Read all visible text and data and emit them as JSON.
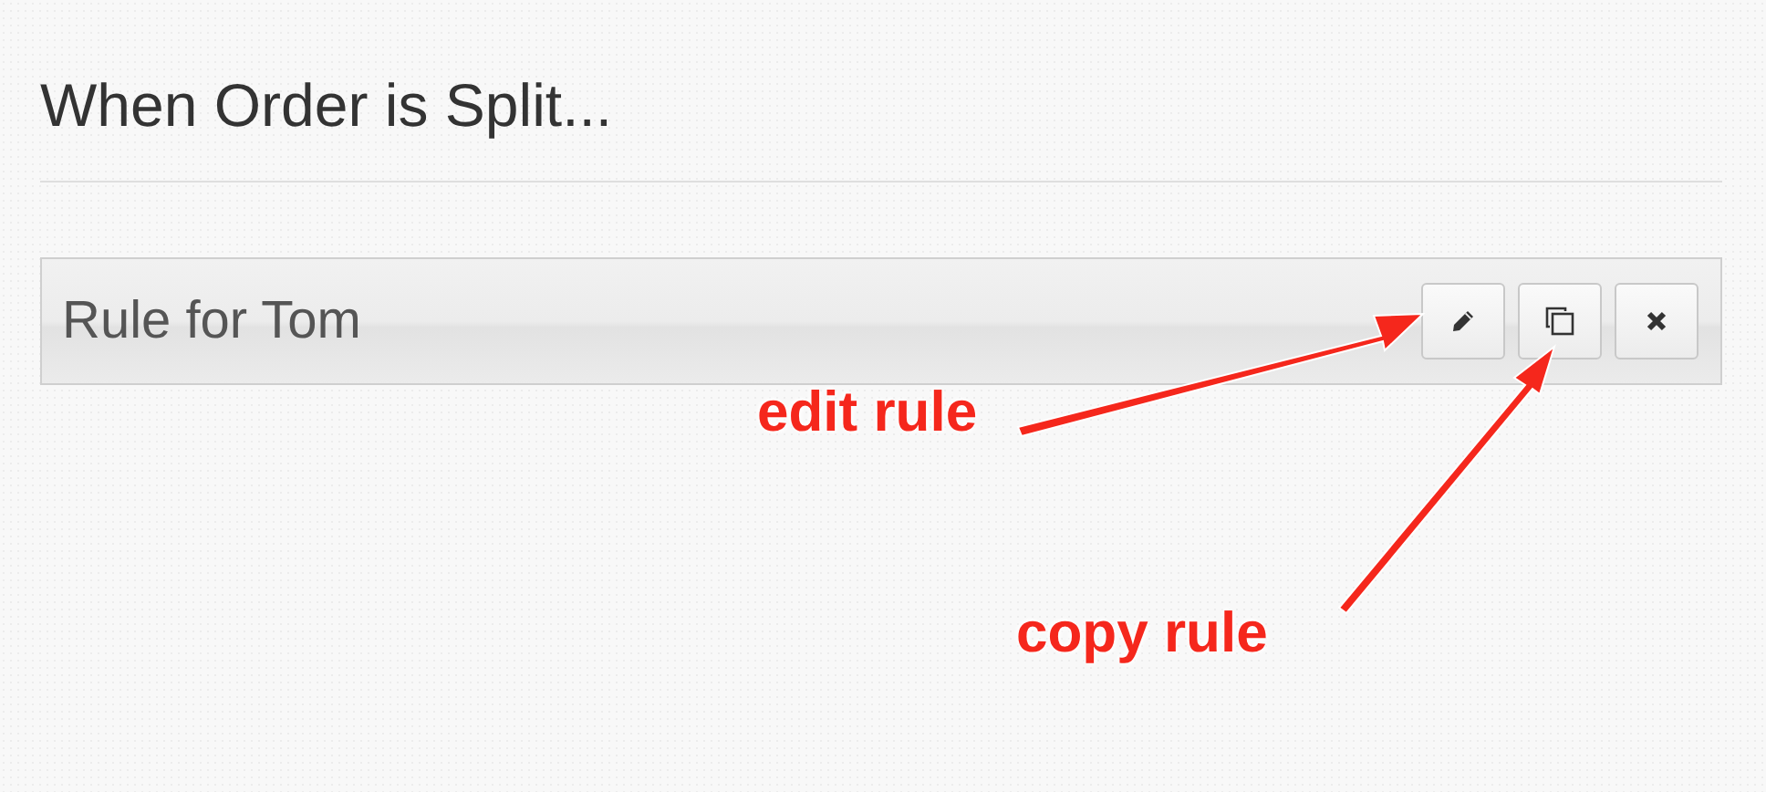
{
  "heading": "When Order is Split...",
  "rules": [
    {
      "name": "Rule for Tom",
      "buttons": [
        {
          "kind": "edit"
        },
        {
          "kind": "copy"
        },
        {
          "kind": "delete"
        }
      ]
    }
  ],
  "annotations": [
    {
      "text": "edit rule"
    },
    {
      "text": "copy rule"
    }
  ]
}
